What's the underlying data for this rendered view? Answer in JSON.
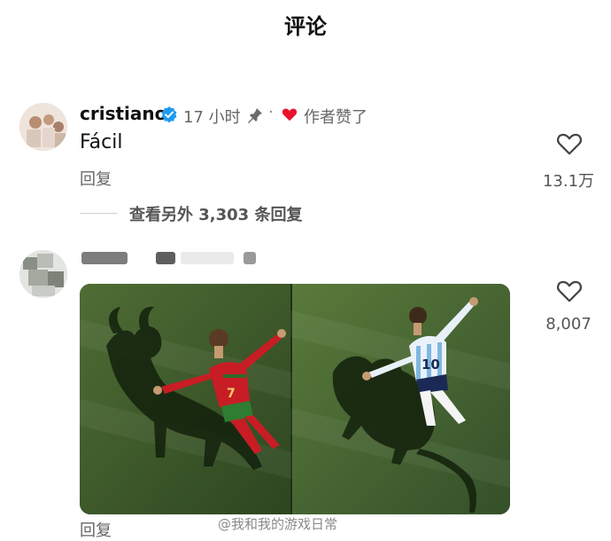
{
  "header": {
    "title": "评论"
  },
  "comments": [
    {
      "username": "cristiano",
      "time": "17 小时",
      "separator": "·",
      "liked_by_author": "作者赞了",
      "text": "Fácil",
      "reply_label": "回复",
      "like_count": "13.1万",
      "more_replies": "查看另外 3,303 条回复"
    },
    {
      "reply_label": "回复",
      "like_count": "8,007"
    }
  ],
  "watermark": "@我和我的游戏日常",
  "colors": {
    "verified": "#1d9bf0",
    "heart": "#e8132b",
    "grass": "#3c5a2a",
    "jersey_red": "#c81d25"
  },
  "icons": [
    "verified-icon",
    "pin-icon",
    "heart-icon",
    "like-outline-icon"
  ]
}
